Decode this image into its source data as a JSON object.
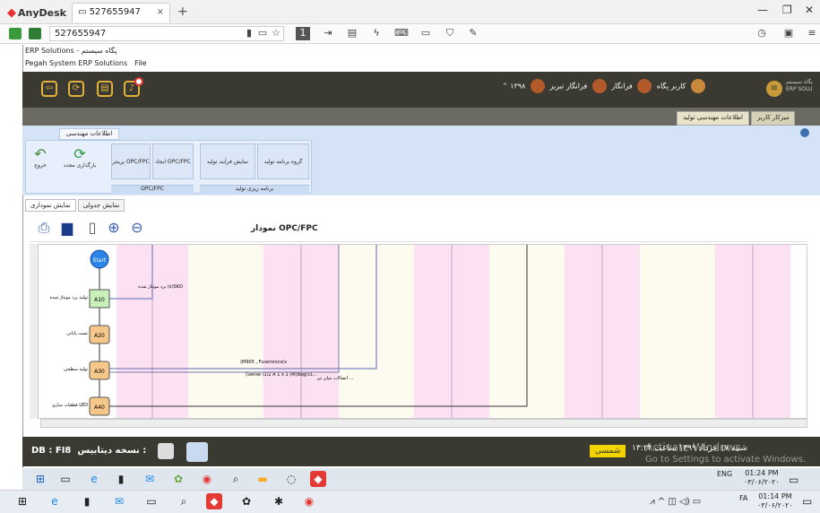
{
  "anydesk": {
    "app_name": "AnyDesk",
    "tab_label": "527655947",
    "address": "527655947"
  },
  "erp": {
    "window_title": "ERP Solutions - پگاه سیستم",
    "menu": [
      "Pegah System ERP Solutions",
      "File"
    ],
    "header_user": "فرانگار تبریز",
    "header_org": "فرانگار",
    "header_user2": "کاربر پگاه",
    "header_year": "۱۳۹۸",
    "system_name": "پگاه سیستم ERP SOLU",
    "open_tabs": [
      "اطلاعات مهندسی تولید",
      "میزکار کاربر"
    ],
    "ribbon_tab": "اطلاعات مهندسی تولید",
    "ribbon_buttons": [
      "خروج",
      "بارگذاری مجدد",
      "پرینتر OPC/FPC",
      "ایجاد OPC/FPC",
      "نمایش فرآیند تولید",
      "گروه برنامه تولید"
    ],
    "ribbon_groups": [
      "OPC/FPC",
      "برنامه ریزی تولید"
    ],
    "subtabs": [
      "نمایش نموداری",
      "نمایش جدولی"
    ],
    "diagram_title": "نمودار OPC/FPC",
    "db_label": "DB : FI8",
    "db_version_label": "نسخه دیتابیس :",
    "shamsi": "شمسی",
    "date_text": "شنبه ۱۷ خرداد ۱۳۹۹  ساعت ۱۳:۲۴",
    "activate_title": "Activate Windows",
    "activate_sub": "Go to Settings to activate Windows."
  },
  "diagram": {
    "nodes": [
      "Start",
      "A10",
      "A20",
      "A30",
      "A40"
    ],
    "node_labels": [
      "تولید برد مونتاژ شده",
      "تست پایانی",
      "تولید سطحی",
      "قطعات سازی LED"
    ],
    "edge_labels": [
      "برد مونتاژ شده (x)SKD",
      "(M905 , Fuseronics(x",
      "(Sense (1/2 A 1 x 1 (M)Bag(x1...",
      "اتصالات میان تیر ..."
    ]
  },
  "taskbar_remote": {
    "time": "01:24 PM",
    "date": "۰۳/۰۶/۲۰۲۰",
    "lang": "ENG"
  },
  "taskbar_local": {
    "time": "01:14 PM",
    "date": "۰۳/۰۶/۲۰۲۰",
    "lang": "FA"
  },
  "colors": {
    "erp_dark": "#3a3a32",
    "accent_gold": "#e2b13b",
    "shamsi_yellow": "#f2d400",
    "anydesk_red": "#e8322f"
  }
}
